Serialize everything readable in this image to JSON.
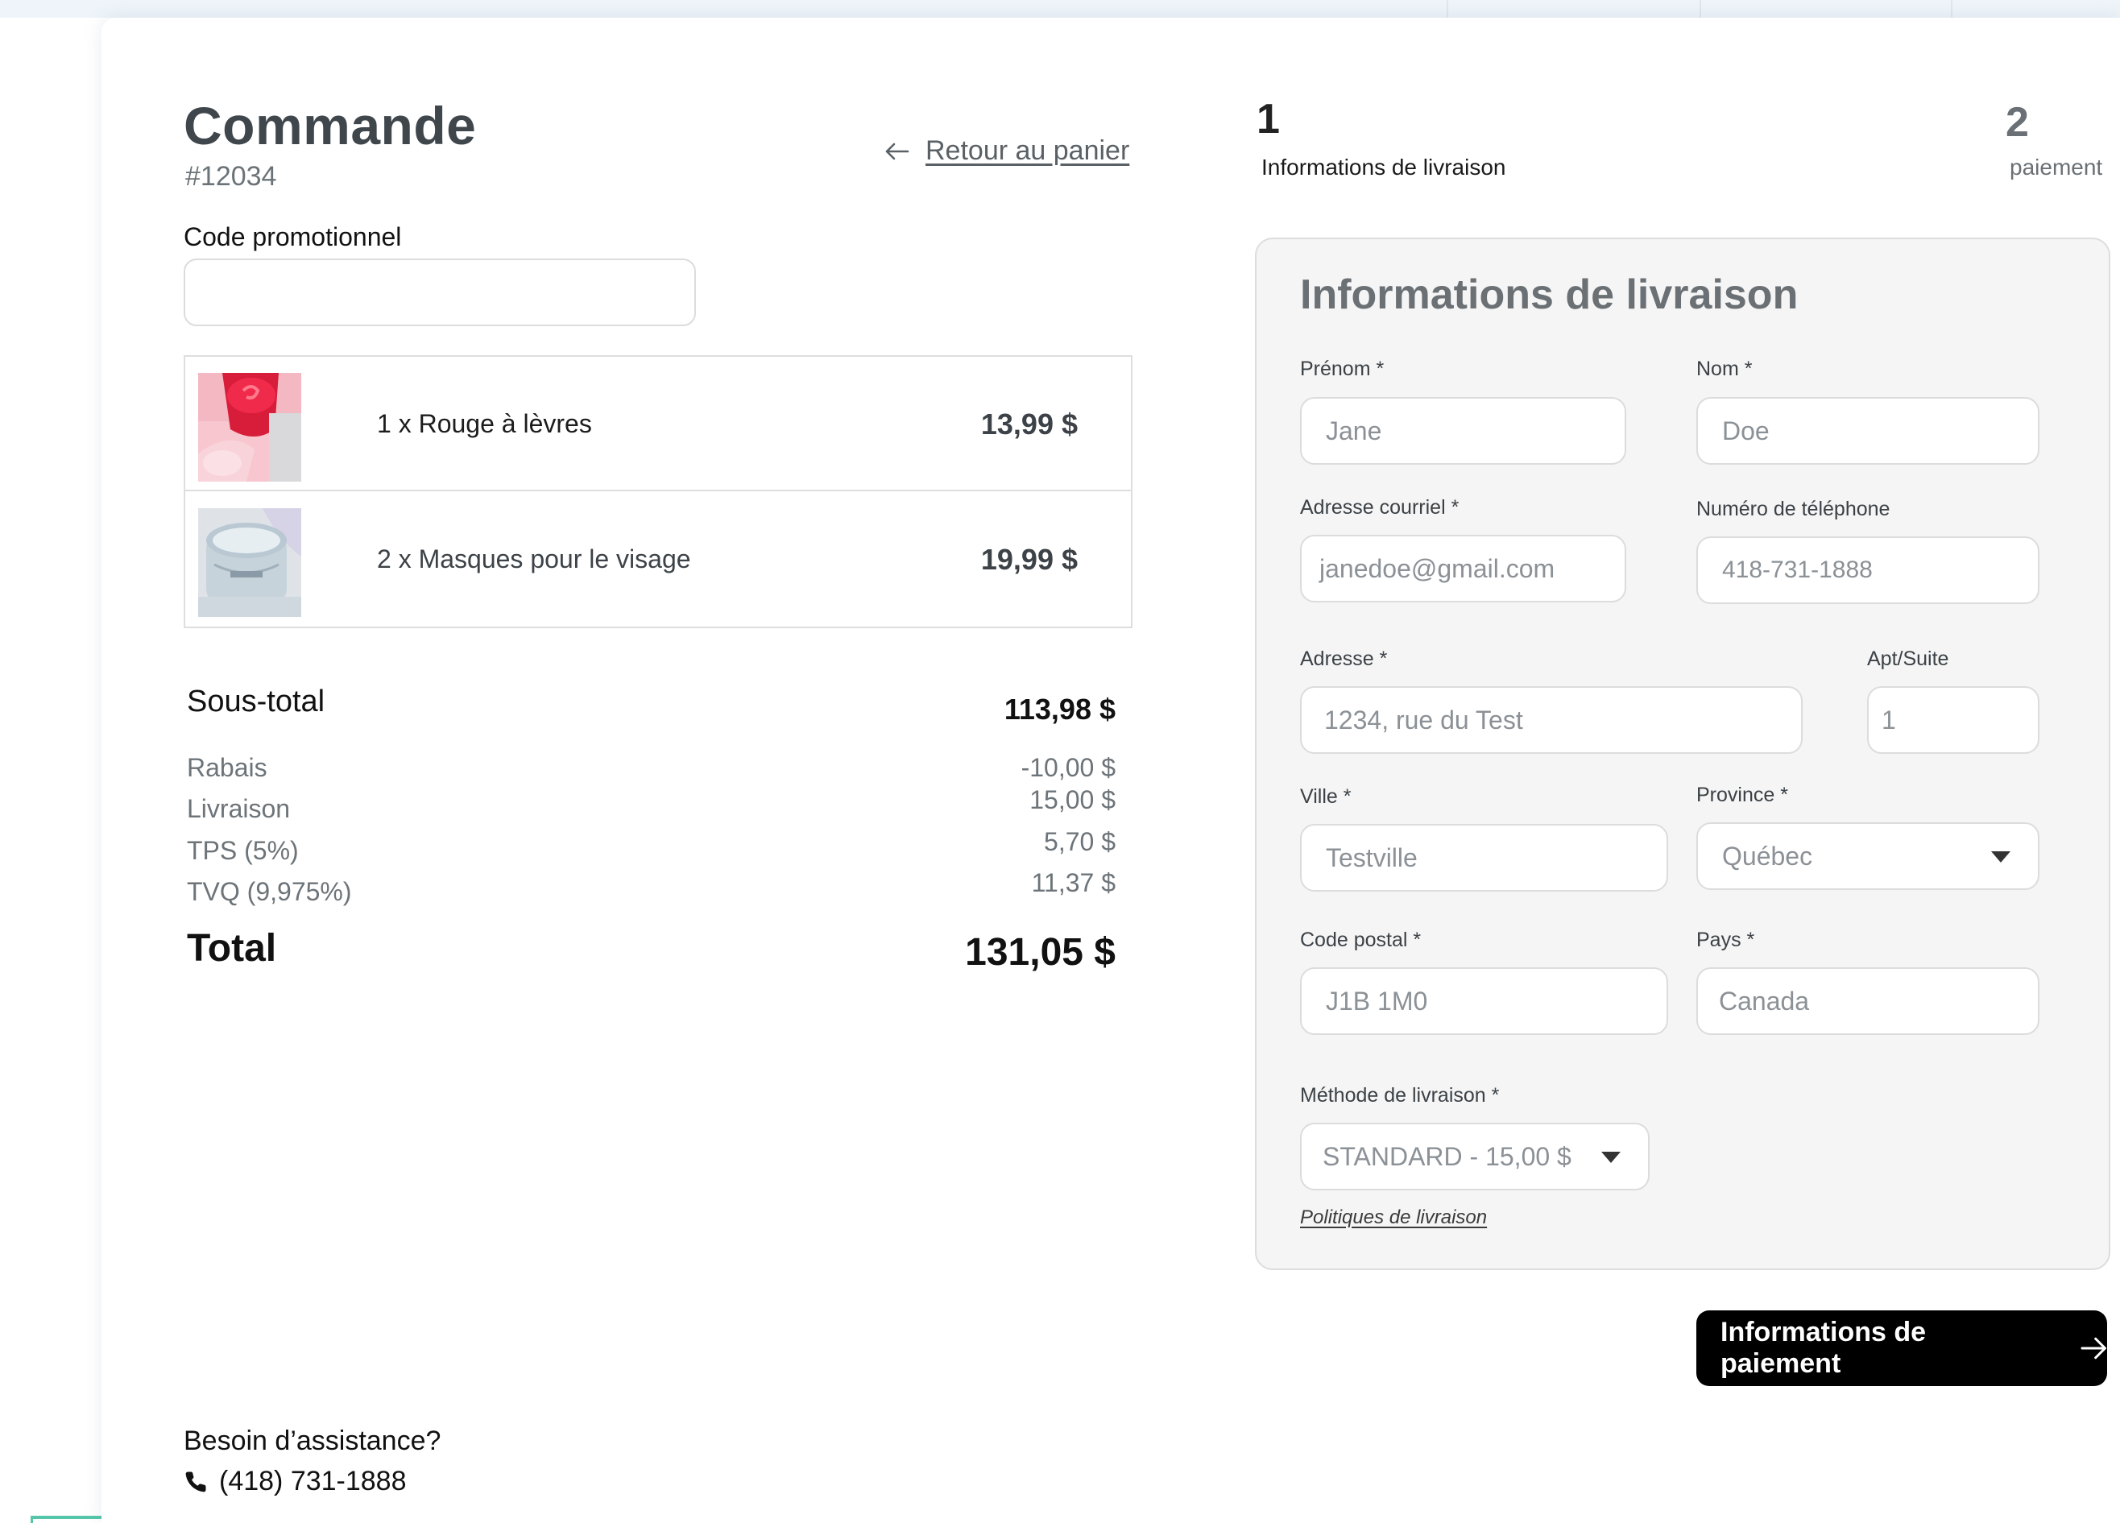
{
  "order": {
    "title": "Commande",
    "number": "#12034",
    "back_link": "Retour au panier"
  },
  "promo": {
    "label": "Code promotionnel",
    "value": ""
  },
  "items": [
    {
      "name": "1 x Rouge à lèvres",
      "price": "13,99 $",
      "image": "lipstick-photo"
    },
    {
      "name": "2 x Masques pour le visage",
      "price": "19,99 $",
      "image": "face-mask-jar-photo"
    }
  ],
  "summary": {
    "subtotal_label": "Sous-total",
    "subtotal_value": "113,98 $",
    "rows": [
      {
        "label": "Rabais",
        "value": "-10,00 $"
      },
      {
        "label": "Livraison",
        "value": "15,00 $"
      },
      {
        "label": "TPS (5%)",
        "value": "5,70 $"
      },
      {
        "label": "TVQ (9,975%)",
        "value": "11,37 $"
      }
    ],
    "total_label": "Total",
    "total_value": "131,05 $"
  },
  "support": {
    "title": "Besoin d’assistance?",
    "phone": "(418) 731-1888"
  },
  "steps": [
    {
      "number": "1",
      "label": "Informations de livraison"
    },
    {
      "number": "2",
      "label": "paiement"
    }
  ],
  "form": {
    "title": "Informations de livraison",
    "first_name": {
      "label": "Prénom *",
      "value": "Jane"
    },
    "last_name": {
      "label": "Nom *",
      "value": "Doe"
    },
    "email": {
      "label": "Adresse courriel  *",
      "value": "janedoe@gmail.com"
    },
    "phone": {
      "label": "Numéro de téléphone",
      "value": "418-731-1888"
    },
    "address": {
      "label": "Adresse *",
      "value": "1234, rue du Test"
    },
    "apt": {
      "label": "Apt/Suite",
      "value": "1"
    },
    "city": {
      "label": "Ville *",
      "value": "Testville"
    },
    "province": {
      "label": "Province *",
      "value": "Québec"
    },
    "postal": {
      "label": "Code postal *",
      "value": "J1B 1M0"
    },
    "country": {
      "label": "Pays *",
      "value": "Canada"
    },
    "shipping_method": {
      "label": "Méthode de livraison  *",
      "value": "STANDARD - 15,00 $"
    },
    "policy_link": "Politiques de livraison"
  },
  "payment_button": "Informations de paiement"
}
